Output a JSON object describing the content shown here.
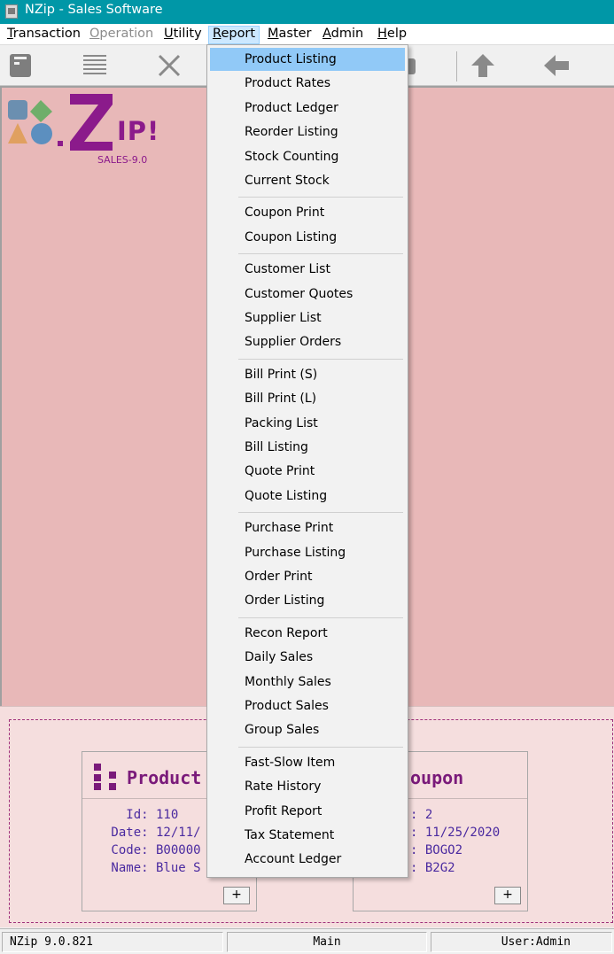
{
  "window": {
    "title": "NZip - Sales Software"
  },
  "menubar": [
    {
      "pre": "",
      "mn": "T",
      "post": "ransaction",
      "state": "normal"
    },
    {
      "pre": "",
      "mn": "O",
      "post": "peration",
      "state": "disabled"
    },
    {
      "pre": "",
      "mn": "U",
      "post": "tility",
      "state": "normal"
    },
    {
      "pre": "",
      "mn": "R",
      "post": "eport",
      "state": "active"
    },
    {
      "pre": "",
      "mn": "M",
      "post": "aster",
      "state": "normal"
    },
    {
      "pre": "",
      "mn": "A",
      "post": "dmin",
      "state": "normal"
    },
    {
      "pre": "",
      "mn": "H",
      "post": "elp",
      "state": "normal"
    }
  ],
  "toolbar": {
    "icons": [
      "new-icon",
      "list-icon",
      "delete-icon",
      "up-arrow-icon",
      "left-arrow-icon"
    ]
  },
  "logo": {
    "word": "IP!",
    "subtitle": "SALES-9.0"
  },
  "report_menu": {
    "groups": [
      [
        "Product Listing",
        "Product Rates",
        "Product Ledger",
        "Reorder Listing",
        "Stock Counting",
        "Current Stock"
      ],
      [
        "Coupon Print",
        "Coupon Listing"
      ],
      [
        "Customer List",
        "Customer Quotes",
        "Supplier List",
        "Supplier Orders"
      ],
      [
        "Bill Print (S)",
        "Bill Print (L)",
        "Packing List",
        "Bill Listing",
        "Quote Print",
        "Quote Listing"
      ],
      [
        "Purchase Print",
        "Purchase Listing",
        "Order Print",
        "Order Listing"
      ],
      [
        "Recon Report",
        "Daily Sales",
        "Monthly Sales",
        "Product Sales",
        "Group Sales"
      ],
      [
        "Fast-Slow Item",
        "Rate History",
        "Profit Report",
        "Tax Statement",
        "Account Ledger"
      ]
    ],
    "highlighted": "Product Listing"
  },
  "product_card": {
    "title": "Product",
    "fields": [
      "   Id: 110",
      " Date: 12/11/",
      " Code: B00000",
      " Name: Blue S"
    ],
    "plus_label": "+"
  },
  "coupon_card": {
    "title": "oupon",
    "fields": [
      ": 2",
      ": 11/25/2020",
      ": BOGO2",
      ": B2G2"
    ],
    "plus_label": "+"
  },
  "statusbar": {
    "version": "NZip 9.0.821",
    "screen": "Main",
    "user": "User:Admin"
  },
  "colors": {
    "titlebar": "#0097a7",
    "workspace": "#e8b8b8",
    "brand": "#8b1a8b",
    "highlight": "#91c9f7"
  }
}
